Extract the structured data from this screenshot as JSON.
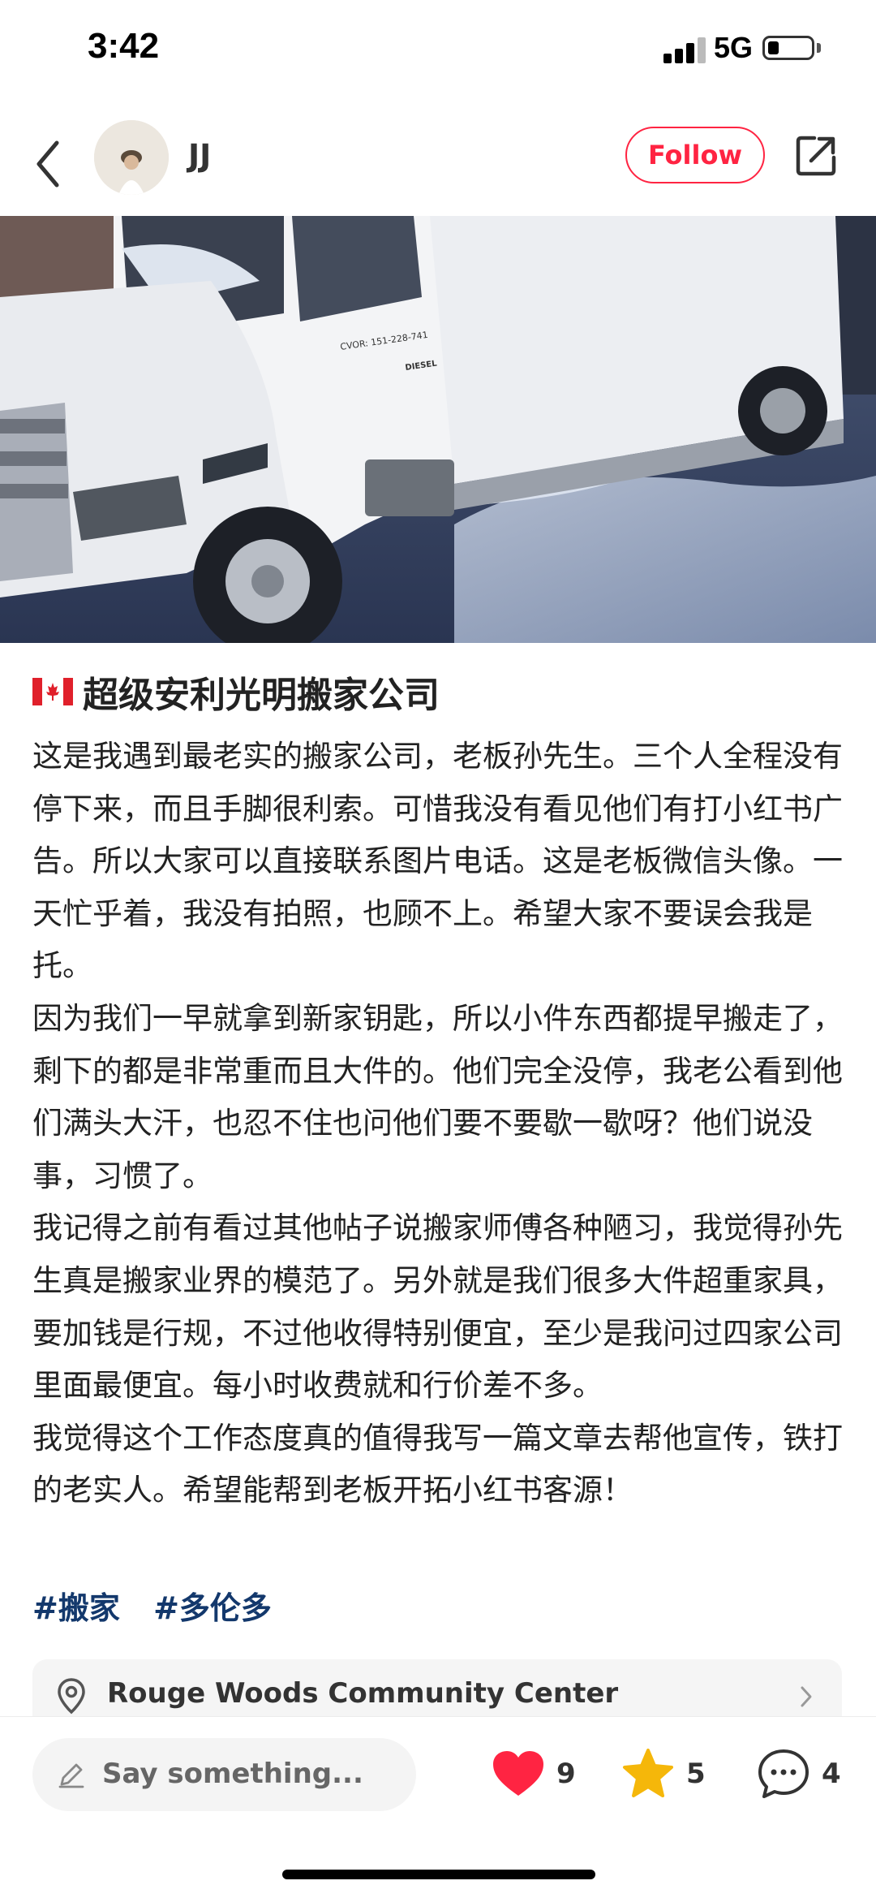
{
  "status_bar": {
    "time": "3:42",
    "network": "5G",
    "battery_level": 0.25
  },
  "header": {
    "username": "JJ",
    "follow_label": "Follow"
  },
  "post": {
    "title": "超级安利光明搬家公司",
    "paragraphs": [
      "这是我遇到最老实的搬家公司，老板孙先生。三个人全程没有停下来，而且手脚很利索。可惜我没有看见他们有打小红书广告。所以大家可以直接联系图片电话。这是老板微信头像。一天忙乎着，我没有拍照，也顾不上。希望大家不要误会我是托。",
      "因为我们一早就拿到新家钥匙，所以小件东西都提早搬走了，剩下的都是非常重而且大件的。他们完全没停，我老公看到他们满头大汗，也忍不住也问他们要不要歇一歇呀？他们说没事，习惯了。",
      "我记得之前有看过其他帖子说搬家师傅各种陋习，我觉得孙先生真是搬家业界的模范了。另外就是我们很多大件超重家具，要加钱是行规，不过他收得特别便宜，至少是我问过四家公司里面最便宜。每小时收费就和行价差不多。",
      "我觉得这个工作态度真的值得我写一篇文章去帮他宣传，铁打的老实人。希望能帮到老板开拓小红书客源！"
    ],
    "tags": [
      "#搬家",
      "#多伦多"
    ],
    "location": "Rouge Woods Community Center",
    "photo_text": {
      "cvor": "CVOR: 151-228-741",
      "diesel": "DIESEL"
    }
  },
  "bottom_bar": {
    "comment_placeholder": "Say something...",
    "likes": "9",
    "favorites": "5",
    "comments": "4"
  },
  "colors": {
    "accent": "#ff2442",
    "tag": "#13386c",
    "star": "#f5b70a"
  }
}
